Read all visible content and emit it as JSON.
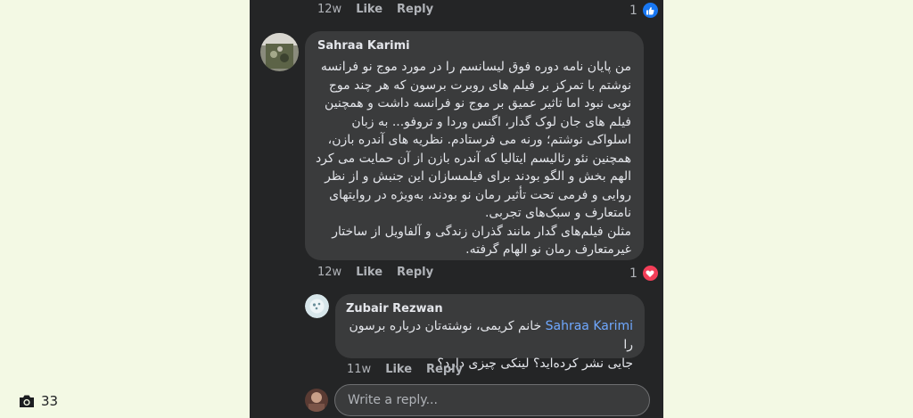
{
  "comment_top": {
    "time": "12w",
    "like_label": "Like",
    "reply_label": "Reply",
    "reaction_count": "1",
    "reaction_icon": "like-icon"
  },
  "comment_main": {
    "author": "Sahraa Karimi",
    "lines": [
      "من پایان نامه دوره فوق لیسانسم را  در مورد موج نو فرانسه",
      "نوشتم با تمرکز بر فیلم های روبرت برسون که هر چند موج",
      "نویی نبود اما تاثیر عمیق بر موج نو فرانسه داشت و همچنین",
      "فیلم های جان لوک گدار، اگنس وردا و  تروفو... به زبان",
      "اسلواکی نوشتم؛ ورنه می فرستادم. نظریه های آندره بازن،",
      "همچنین نئو رئالیسم ایتالیا که آندره بازن از آن حمایت می کرد",
      "الهم بخش و الگو بودند برای فیلمسازان این جنبش و از نظر",
      "روایی و فرمی تحت تأثیر رمان نو بودند، به‌ویژه در روایتهای",
      "نامتعارف و سبک‌های تجربی.",
      "مثلن فیلم‌های گدار مانند گذران زندگی و آلفاویل از ساختار",
      "غیرمتعارف رمان نو الهام گرفته."
    ],
    "time": "12w",
    "like_label": "Like",
    "reply_label": "Reply",
    "reaction_count": "1",
    "reaction_icon": "heart-icon"
  },
  "comment_reply": {
    "author": "Zubair Rezwan",
    "mention": "Sahraa Karimi",
    "line1_rest": " خانم کریمی، نوشته‌تان درباره برسون را",
    "line2": "جایی نشر کرده‌اید؟ لینکی چیزی دارد؟",
    "time": "11w",
    "like_label": "Like",
    "reply_label": "Reply"
  },
  "reply_input": {
    "placeholder": "Write a reply..."
  },
  "photo_count": "33",
  "colors": {
    "page_bg": "#f3f9e4",
    "panel_bg": "#242526",
    "bubble_bg": "#3a3b3c",
    "mention": "#6fa8ff",
    "like_blue": "#1877f2",
    "love_red": "#f33e58"
  }
}
